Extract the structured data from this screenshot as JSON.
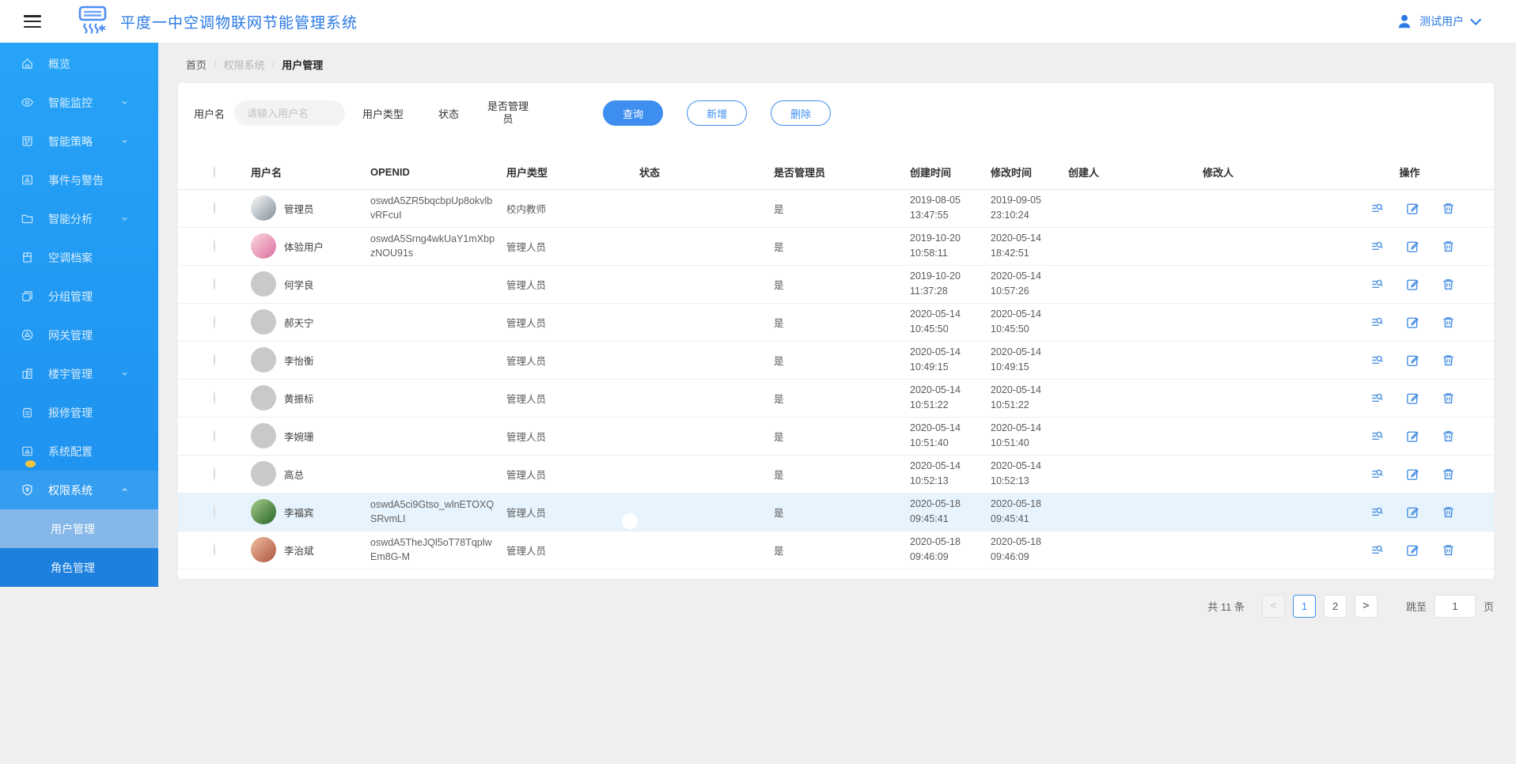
{
  "header": {
    "title": "平度一中空调物联网节能管理系统",
    "user": {
      "name": "测试用户"
    }
  },
  "sidebar": {
    "items": [
      {
        "label": "概览"
      },
      {
        "label": "智能监控"
      },
      {
        "label": "智能策略"
      },
      {
        "label": "事件与警告"
      },
      {
        "label": "智能分析"
      },
      {
        "label": "空调档案"
      },
      {
        "label": "分组管理"
      },
      {
        "label": "网关管理"
      },
      {
        "label": "楼宇管理"
      },
      {
        "label": "报修管理"
      },
      {
        "label": "系统配置"
      },
      {
        "label": "权限系统"
      }
    ],
    "submenu": [
      {
        "label": "用户管理",
        "active": true
      },
      {
        "label": "角色管理",
        "active": false
      }
    ]
  },
  "breadcrumb": {
    "home": "首页",
    "section": "权限系统",
    "current": "用户管理"
  },
  "filters": {
    "username_label": "用户名",
    "username_placeholder": "请输入用户名",
    "usertype_label": "用户类型",
    "status_label": "状态",
    "admin_label": "是否管理员",
    "query_label": "查询",
    "add_label": "新增",
    "delete_label": "删除"
  },
  "table": {
    "columns": [
      "用户名",
      "OPENID",
      "用户类型",
      "状态",
      "是否管理员",
      "创建时间",
      "修改时间",
      "创建人",
      "修改人",
      "操作"
    ],
    "rows": [
      {
        "name": "管理员",
        "openid": "oswdA5ZR5bqcbpUp8okvlbvRFcuI",
        "type": "校内教师",
        "status_on": true,
        "admin": "是",
        "created": "2019-08-05 13:47:55",
        "modified": "2019-09-05 23:10:24",
        "creator": "",
        "modifier": "",
        "avatar": "photo-gray",
        "highlight": false
      },
      {
        "name": "体验用户",
        "openid": "oswdA5Srng4wkUaY1mXbpzNOU91s",
        "type": "管理人员",
        "status_on": true,
        "admin": "是",
        "created": "2019-10-20 10:58:11",
        "modified": "2020-05-14 18:42:51",
        "creator": "",
        "modifier": "",
        "avatar": "photo-pink",
        "highlight": false
      },
      {
        "name": "何学良",
        "openid": "",
        "type": "管理人员",
        "status_on": true,
        "admin": "是",
        "created": "2019-10-20 11:37:28",
        "modified": "2020-05-14 10:57:26",
        "creator": "",
        "modifier": "",
        "avatar": "none",
        "highlight": false
      },
      {
        "name": "郝天宁",
        "openid": "",
        "type": "管理人员",
        "status_on": true,
        "admin": "是",
        "created": "2020-05-14 10:45:50",
        "modified": "2020-05-14 10:45:50",
        "creator": "",
        "modifier": "",
        "avatar": "none",
        "highlight": false
      },
      {
        "name": "李怡衡",
        "openid": "",
        "type": "管理人员",
        "status_on": true,
        "admin": "是",
        "created": "2020-05-14 10:49:15",
        "modified": "2020-05-14 10:49:15",
        "creator": "",
        "modifier": "",
        "avatar": "none",
        "highlight": false
      },
      {
        "name": "黄振标",
        "openid": "",
        "type": "管理人员",
        "status_on": true,
        "admin": "是",
        "created": "2020-05-14 10:51:22",
        "modified": "2020-05-14 10:51:22",
        "creator": "",
        "modifier": "",
        "avatar": "none",
        "highlight": false
      },
      {
        "name": "李婉珊",
        "openid": "",
        "type": "管理人员",
        "status_on": true,
        "admin": "是",
        "created": "2020-05-14 10:51:40",
        "modified": "2020-05-14 10:51:40",
        "creator": "",
        "modifier": "",
        "avatar": "none",
        "highlight": false
      },
      {
        "name": "高总",
        "openid": "",
        "type": "管理人员",
        "status_on": true,
        "admin": "是",
        "created": "2020-05-14 10:52:13",
        "modified": "2020-05-14 10:52:13",
        "creator": "",
        "modifier": "",
        "avatar": "none",
        "highlight": false
      },
      {
        "name": "李福宾",
        "openid": "oswdA5ci9Gtso_wlnETOXQSRvmLI",
        "type": "管理人员",
        "status_on": true,
        "admin": "是",
        "created": "2020-05-18 09:45:41",
        "modified": "2020-05-18 09:45:41",
        "creator": "",
        "modifier": "",
        "avatar": "photo-green",
        "highlight": true
      },
      {
        "name": "李治斌",
        "openid": "oswdA5TheJQl5oT78TqplwEm8G-M",
        "type": "管理人员",
        "status_on": true,
        "admin": "是",
        "created": "2020-05-18 09:46:09",
        "modified": "2020-05-18 09:46:09",
        "creator": "",
        "modifier": "",
        "avatar": "photo-skin",
        "highlight": false
      }
    ]
  },
  "pagination": {
    "total": "共 11 条",
    "page1": "1",
    "page2": "2",
    "jump_label": "跳至",
    "jump_value": "1",
    "jump_suffix": "页"
  },
  "colors": {
    "primary": "#1890ff",
    "sidebar": "#1f96f2",
    "title_blue": "#2a7ae4",
    "action_icon": "#4a90e2",
    "badge_yellow": "#f6c33e",
    "highlight_row": "#e8f4fd"
  }
}
